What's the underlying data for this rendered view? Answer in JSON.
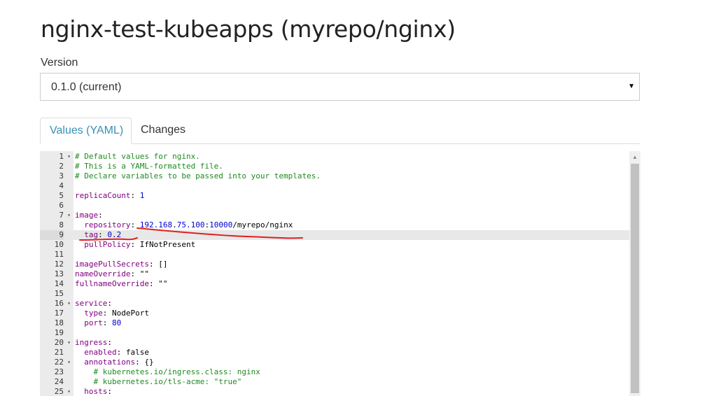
{
  "page": {
    "title": "nginx-test-kubeapps (myrepo/nginx)"
  },
  "version": {
    "label": "Version",
    "selected": "0.1.0 (current)"
  },
  "tabs": [
    {
      "label": "Values (YAML)",
      "active": true
    },
    {
      "label": "Changes",
      "active": false
    }
  ],
  "editor": {
    "active_line": 9,
    "lines": [
      {
        "n": "1",
        "fold": true,
        "text": "# Default values for nginx."
      },
      {
        "n": "2",
        "fold": false,
        "text": "# This is a YAML-formatted file."
      },
      {
        "n": "3",
        "fold": false,
        "text": "# Declare variables to be passed into your templates."
      },
      {
        "n": "4",
        "fold": false,
        "text": ""
      },
      {
        "n": "5",
        "fold": false,
        "text": "replicaCount: 1"
      },
      {
        "n": "6",
        "fold": false,
        "text": ""
      },
      {
        "n": "7",
        "fold": true,
        "text": "image:"
      },
      {
        "n": "8",
        "fold": false,
        "text": "  repository: 192.168.75.100:10000/myrepo/nginx"
      },
      {
        "n": "9",
        "fold": false,
        "text": "  tag: 0.2"
      },
      {
        "n": "10",
        "fold": false,
        "text": "  pullPolicy: IfNotPresent"
      },
      {
        "n": "11",
        "fold": false,
        "text": ""
      },
      {
        "n": "12",
        "fold": false,
        "text": "imagePullSecrets: []"
      },
      {
        "n": "13",
        "fold": false,
        "text": "nameOverride: \"\""
      },
      {
        "n": "14",
        "fold": false,
        "text": "fullnameOverride: \"\""
      },
      {
        "n": "15",
        "fold": false,
        "text": ""
      },
      {
        "n": "16",
        "fold": true,
        "text": "service:"
      },
      {
        "n": "17",
        "fold": false,
        "text": "  type: NodePort"
      },
      {
        "n": "18",
        "fold": false,
        "text": "  port: 80"
      },
      {
        "n": "19",
        "fold": false,
        "text": ""
      },
      {
        "n": "20",
        "fold": true,
        "text": "ingress:"
      },
      {
        "n": "21",
        "fold": false,
        "text": "  enabled: false"
      },
      {
        "n": "22",
        "fold": true,
        "text": "  annotations: {}"
      },
      {
        "n": "23",
        "fold": false,
        "text": "    # kubernetes.io/ingress.class: nginx"
      },
      {
        "n": "24",
        "fold": false,
        "text": "    # kubernetes.io/tls-acme: \"true\""
      },
      {
        "n": "25",
        "fold": true,
        "text": "  hosts:"
      }
    ]
  },
  "icons": {
    "select_caret": "chevron-down-icon",
    "fold_marker": "fold-arrow-icon",
    "scroll_up": "scroll-up-arrow-icon"
  },
  "colors": {
    "active_tab_text": "#3a8fb7",
    "comment": "#1f8a1f",
    "key": "#800080",
    "number": "#0000cd",
    "annotation": "#e02020"
  }
}
